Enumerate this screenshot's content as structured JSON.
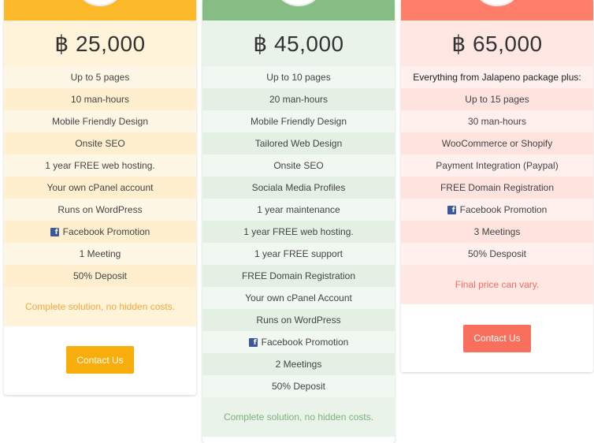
{
  "colors": {
    "orange": "#fbb829",
    "green": "#86bd85",
    "red": "#ff7f6b",
    "facebook": "#3b5998"
  },
  "plans": [
    {
      "price": "฿ 25,000",
      "features": [
        "Up to 5 pages",
        "10 man-hours",
        "Mobile Friendly Design",
        "Onsite SEO",
        "1 year FREE web hosting.",
        "Your own cPanel account",
        "Runs on WordPress",
        "Facebook Promotion",
        "1 Meeting",
        "50% Deposit"
      ],
      "note": "Complete solution, no hidden costs.",
      "button": "Contact Us"
    },
    {
      "price": "฿ 45,000",
      "features": [
        "Up to 10 pages",
        "20 man-hours",
        "Mobile Friendly Design",
        "Tailored Web Design",
        "Onsite SEO",
        "Sociala Media Profiles",
        "1 year maintenance",
        "1 year FREE web hosting.",
        "1 year FREE support",
        "FREE Domain Registration",
        "Your own cPanel Account",
        "Runs on WordPress",
        "Facebook Promotion",
        "2 Meetings",
        "50% Deposit"
      ],
      "note": "Complete solution, no hidden costs."
    },
    {
      "price": "฿ 65,000",
      "features": [
        "Everything from Jalapeno package plus:",
        "Up to 15 pages",
        "30 man-hours",
        "WooCommerce or Shopify",
        "Payment Integration (Paypal)",
        "FREE Domain Registration",
        "Facebook Promotion",
        "3 Meetings",
        "50% Desposit"
      ],
      "note": "Final price can vary.",
      "button": "Contact Us"
    }
  ],
  "icons": {
    "facebook": "facebook-icon"
  }
}
